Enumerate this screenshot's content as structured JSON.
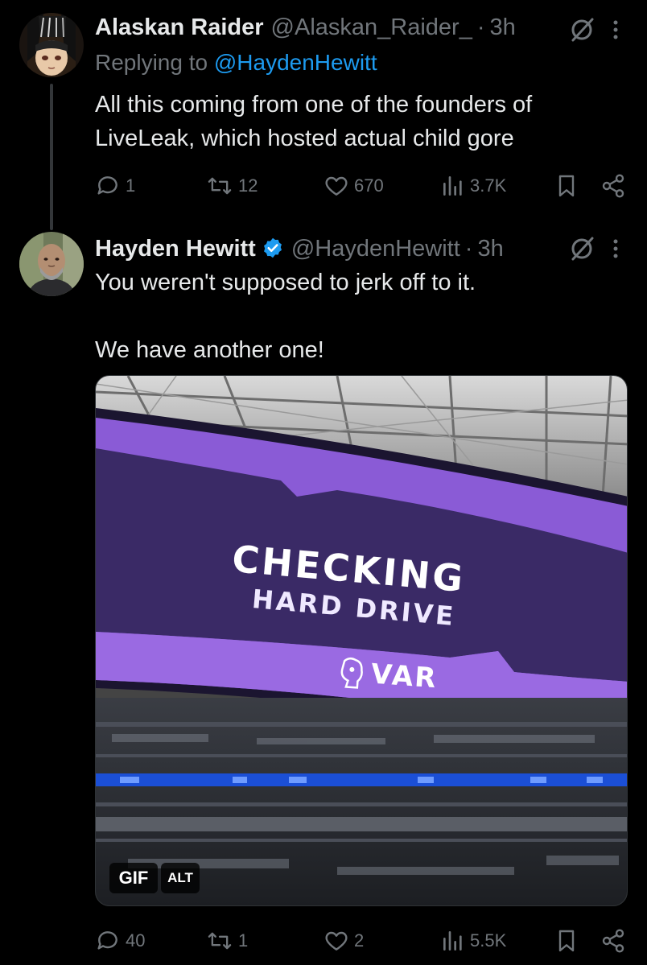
{
  "tweet1": {
    "display_name": "Alaskan Raider",
    "handle": "@Alaskan_Raider_",
    "separator": "·",
    "time": "3h",
    "replying_label": "Replying to",
    "replying_to": "@HaydenHewitt",
    "text": "All this coming from one of the founders of\nLiveLeak, which hosted actual child gore",
    "stats": {
      "replies": "1",
      "reposts": "12",
      "likes": "670",
      "views": "3.7K"
    }
  },
  "tweet2": {
    "display_name": "Hayden Hewitt",
    "handle": "@HaydenHewitt",
    "separator": "·",
    "time": "3h",
    "verified": true,
    "text": "You weren't supposed to jerk off to it.\n\nWe have another one!",
    "media": {
      "headline": "CHECKING",
      "subline": "HARD DRIVE",
      "logo_text": "VAR",
      "gif_badge": "GIF",
      "alt_badge": "ALT"
    },
    "stats": {
      "replies": "40",
      "reposts": "1",
      "likes": "2",
      "views": "5.5K"
    }
  },
  "icons": {
    "reply": "reply-icon",
    "repost": "repost-icon",
    "like": "like-icon",
    "views": "views-icon",
    "bookmark": "bookmark-icon",
    "share": "share-icon",
    "grok": "grok-icon",
    "more": "more-icon",
    "verified": "verified-badge-icon"
  },
  "colors": {
    "background": "#000000",
    "text": "#e7e9ea",
    "secondary": "#71767b",
    "link": "#1d9bf0",
    "screen_purple": "#8a5bd6",
    "screen_dark": "#3a2a66"
  }
}
